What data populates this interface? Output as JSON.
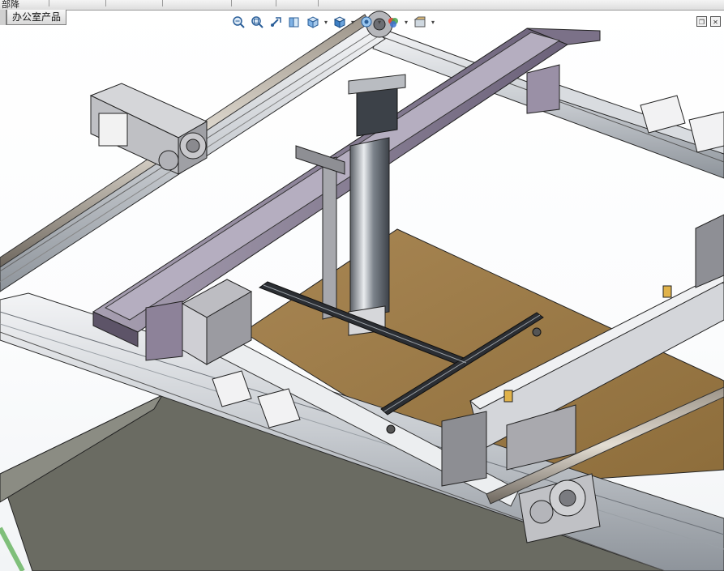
{
  "window": {
    "menu_fragment": "部降",
    "tab_office": "办公室产品"
  },
  "heads_up_toolbar": [
    {
      "icon": "zoom-to-fit-icon"
    },
    {
      "icon": "zoom-to-area-icon"
    },
    {
      "icon": "previous-view-icon"
    },
    {
      "icon": "section-view-icon"
    },
    {
      "icon": "view-orientation-icon",
      "dropdown": true
    },
    {
      "icon": "display-style-icon",
      "dropdown": true
    },
    {
      "icon": "hide-show-items-icon",
      "dropdown": true
    },
    {
      "icon": "edit-appearance-icon",
      "dropdown": true
    },
    {
      "icon": "apply-scene-icon",
      "dropdown": true
    }
  ],
  "window_controls": [
    {
      "icon": "restore-icon"
    },
    {
      "icon": "close-icon"
    }
  ],
  "colors": {
    "frame_aluminum": "#c9cdd2",
    "frame_edge": "#2a2a2a",
    "purple_channel": "#8d8299",
    "purple_dark": "#5d5468",
    "wood_table": "#9a7a46",
    "dark_table": "#6a6b62",
    "green_strip": "#7fbf7a",
    "block_gray": "#a9a9ae"
  }
}
